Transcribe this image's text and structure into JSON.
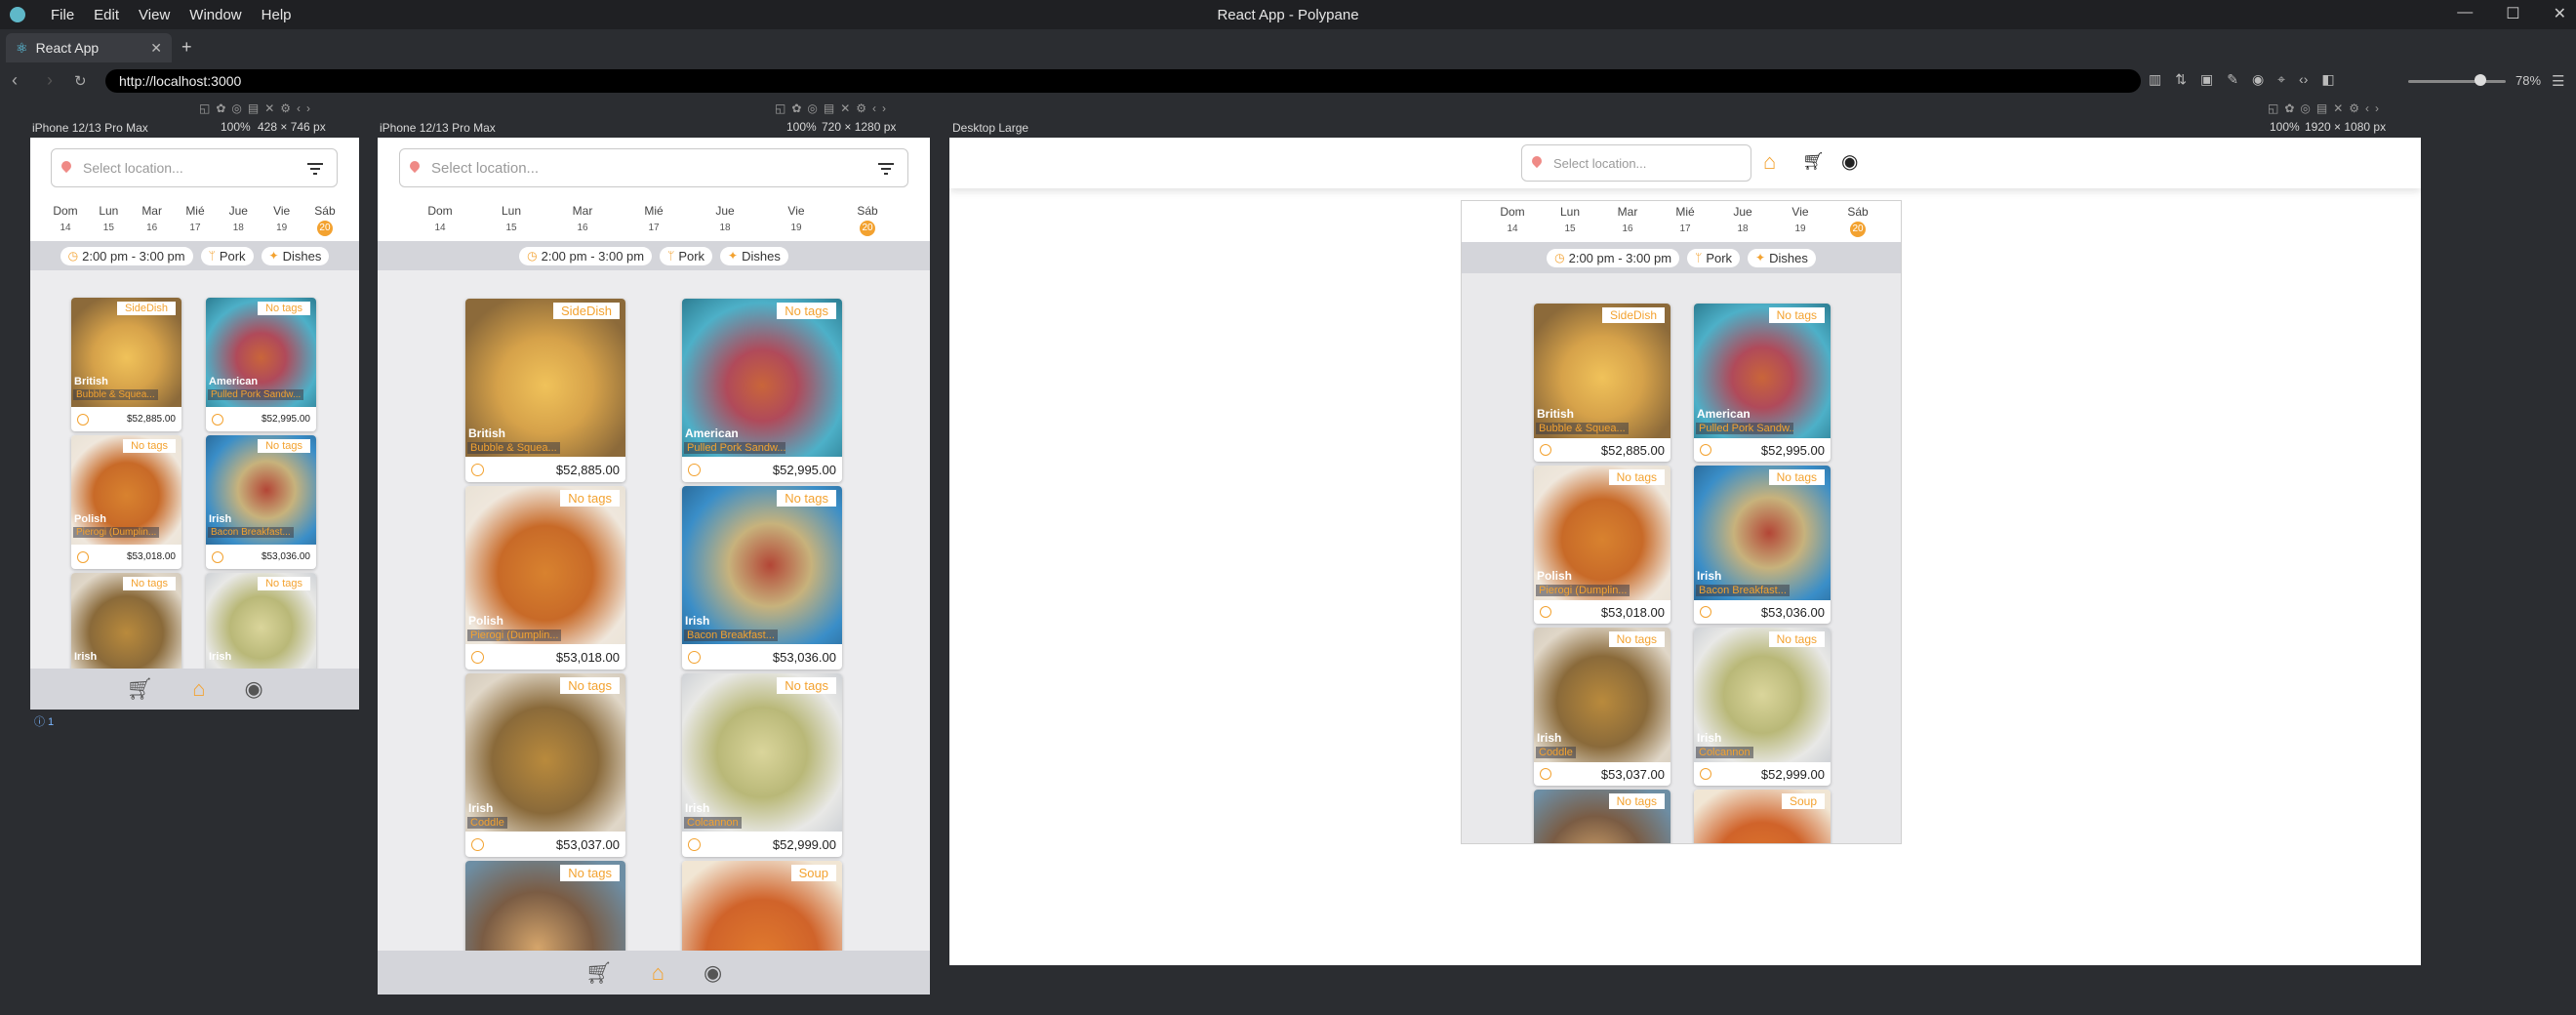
{
  "window": {
    "title": "React App - Polypane",
    "menu": [
      "File",
      "Edit",
      "View",
      "Window",
      "Help"
    ],
    "controls": [
      "—",
      "☐",
      "✕"
    ]
  },
  "tab": {
    "label": "React App",
    "new_tab": "+"
  },
  "address": {
    "url": "http://localhost:3000",
    "zoom": "78%"
  },
  "panes": [
    {
      "label": "iPhone 12/13 Pro Max",
      "zoom": "100%",
      "size": "428 × 746 px"
    },
    {
      "label": "iPhone 12/13 Pro Max",
      "zoom": "100%",
      "size": "720 × 1280 px"
    },
    {
      "label": "Desktop Large",
      "zoom": "100%",
      "size": "1920 × 1080 px"
    }
  ],
  "console_badge": "ⓘ 1",
  "app": {
    "search_placeholder": "Select location...",
    "days": [
      {
        "name": "Dom",
        "num": "14",
        "selected": false
      },
      {
        "name": "Lun",
        "num": "15",
        "selected": false
      },
      {
        "name": "Mar",
        "num": "16",
        "selected": false
      },
      {
        "name": "Mié",
        "num": "17",
        "selected": false
      },
      {
        "name": "Jue",
        "num": "18",
        "selected": false
      },
      {
        "name": "Vie",
        "num": "19",
        "selected": false
      },
      {
        "name": "Sáb",
        "num": "20",
        "selected": true
      }
    ],
    "chips": {
      "time": "2:00 pm - 3:00 pm",
      "meat": "Pork",
      "type": "Dishes"
    },
    "cards": [
      {
        "tag": "SideDish",
        "cuisine": "British",
        "name": "Bubble & Squea...",
        "price": "$52,885.00"
      },
      {
        "tag": "No tags",
        "cuisine": "American",
        "name": "Pulled Pork Sandw...",
        "price": "$52,995.00"
      },
      {
        "tag": "No tags",
        "cuisine": "Polish",
        "name": "Pierogi (Dumplin...",
        "price": "$53,018.00"
      },
      {
        "tag": "No tags",
        "cuisine": "Irish",
        "name": "Bacon Breakfast...",
        "price": "$53,036.00"
      },
      {
        "tag": "No tags",
        "cuisine": "Irish",
        "name": "Coddle",
        "price": "$53,037.00"
      },
      {
        "tag": "No tags",
        "cuisine": "Irish",
        "name": "Colcannon",
        "price": "$52,999.00"
      },
      {
        "tag": "No tags",
        "cuisine": "",
        "name": "",
        "price": ""
      },
      {
        "tag": "Soup",
        "cuisine": "",
        "name": "",
        "price": ""
      }
    ]
  },
  "colors": {
    "accent": "#f3a230",
    "chrome": "#2b2d31",
    "chip_bar": "#d4d5da"
  }
}
